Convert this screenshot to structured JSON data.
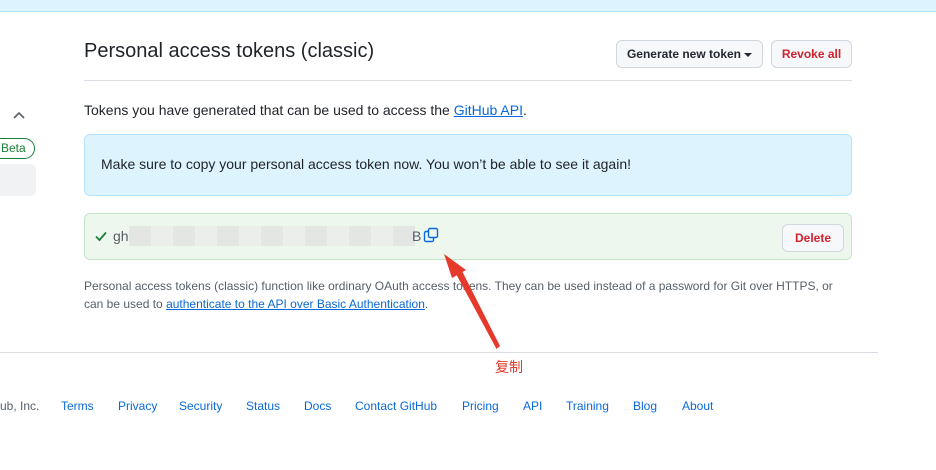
{
  "header": {
    "title": "Personal access tokens (classic)",
    "generate_label": "Generate new token",
    "revoke_all_label": "Revoke all"
  },
  "sidebar": {
    "beta_badge": "Beta"
  },
  "intro": {
    "text_before": "Tokens you have generated that can be used to access the ",
    "link": "GitHub API",
    "text_after": "."
  },
  "flash": {
    "message": "Make sure to copy your personal access token now. You won’t be able to see it again!"
  },
  "token": {
    "prefix": "gh",
    "suffix": "B",
    "delete_label": "Delete"
  },
  "note": {
    "text": "Personal access tokens (classic) function like ordinary OAuth access tokens. They can be used instead of a password for Git over HTTPS, or can be used to ",
    "link": "authenticate to the API over Basic Authentication",
    "end": "."
  },
  "annotation": {
    "label": "复制",
    "color": "#e5392c"
  },
  "footer": {
    "copyright": "ub, Inc.",
    "links": [
      "Terms",
      "Privacy",
      "Security",
      "Status",
      "Docs",
      "Contact GitHub",
      "Pricing",
      "API",
      "Training",
      "Blog",
      "About"
    ]
  },
  "colors": {
    "accent": "#0969da",
    "danger": "#cf222e",
    "success": "#1a7f37",
    "info_bg": "#ddf4ff"
  }
}
